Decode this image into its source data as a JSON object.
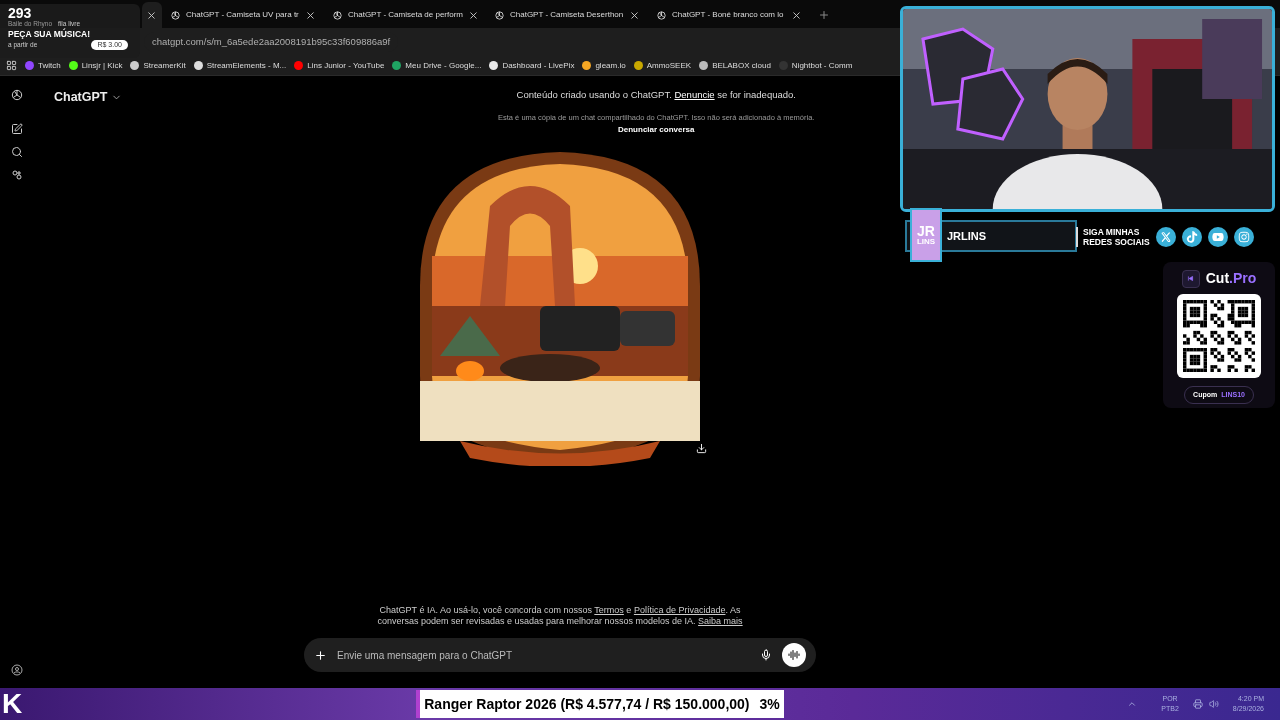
{
  "widget": {
    "count": "293",
    "song": "Baile do Rhyno",
    "queue": "fila livre",
    "title": "PEÇA SUA MÚSICA!",
    "from": "a partir de",
    "price": "R$ 3.00"
  },
  "tabs": [
    {
      "selected": true
    },
    {
      "title": "ChatGPT - Camiseta UV para tr",
      "selected": false
    },
    {
      "title": "ChatGPT - Camiseta de perform",
      "selected": false
    },
    {
      "title": "ChatGPT - Camiseta Deserthon",
      "selected": false
    },
    {
      "title": "ChatGPT - Boné branco com lo",
      "selected": false
    }
  ],
  "address": "chatgpt.com/s/m_6a5ede2aa2008191b95c33f609886a9f",
  "bookmarks": [
    {
      "label": "Twitch",
      "color": "#9146ff"
    },
    {
      "label": "Linsjr | Kick",
      "color": "#53fc18"
    },
    {
      "label": "StreamerKit",
      "color": "#cccccc"
    },
    {
      "label": "StreamElements - M...",
      "color": "#dddddd"
    },
    {
      "label": "Lins Junior - YouTube",
      "color": "#ff0000"
    },
    {
      "label": "Meu Drive - Google...",
      "color": "#1fa463"
    },
    {
      "label": "Dashboard - LivePix",
      "color": "#e8e8e8"
    },
    {
      "label": "gleam.io",
      "color": "#f5a623"
    },
    {
      "label": "AmmoSEEK",
      "color": "#c8a800"
    },
    {
      "label": "BELABOX cloud",
      "color": "#bbbbbb"
    },
    {
      "label": "Nightbot - Comm",
      "color": "#333333"
    }
  ],
  "chat": {
    "brand": "ChatGPT",
    "notice": "Conteúdo criado usando o ChatGPT.",
    "notice_link": "Denuncie",
    "notice_end": "se for inadequado.",
    "copy_note": "Esta é uma cópia de um chat compartilhado do ChatGPT. Isso não será adicionado à memória.",
    "report": "Denunciar conversa",
    "disclaimer": "ChatGPT é IA. Ao usá-lo, você concorda com nossos",
    "terms": "Termos",
    "and": "e",
    "privacy": "Política de Privacidade",
    "disclaimer2": ". As conversas podem ser revisadas e usadas para melhorar nossos modelos de IA.",
    "learn_more": "Saiba mais",
    "input": {
      "placeholder": "Envie uma mensagem para o ChatGPT"
    }
  },
  "social": {
    "logo_top": "JR",
    "logo_bottom": "LINS",
    "name": "JRLINS",
    "follow": "SIGA MINHAS REDES SOCIAIS"
  },
  "promo": {
    "brand": "Cut",
    "brand_suffix": ".Pro",
    "coupon_label": "Cupom",
    "coupon_code": "LINS10"
  },
  "goal": {
    "text": "Ranger Raptor 2026 (R$ 4.577,74 / R$ 150.000,00)",
    "percent": "3%"
  },
  "tray": {
    "language": "POR",
    "layout": "PTB2",
    "time": "4:20 PM",
    "date": "8/29/2026"
  },
  "stream_logo": "K"
}
